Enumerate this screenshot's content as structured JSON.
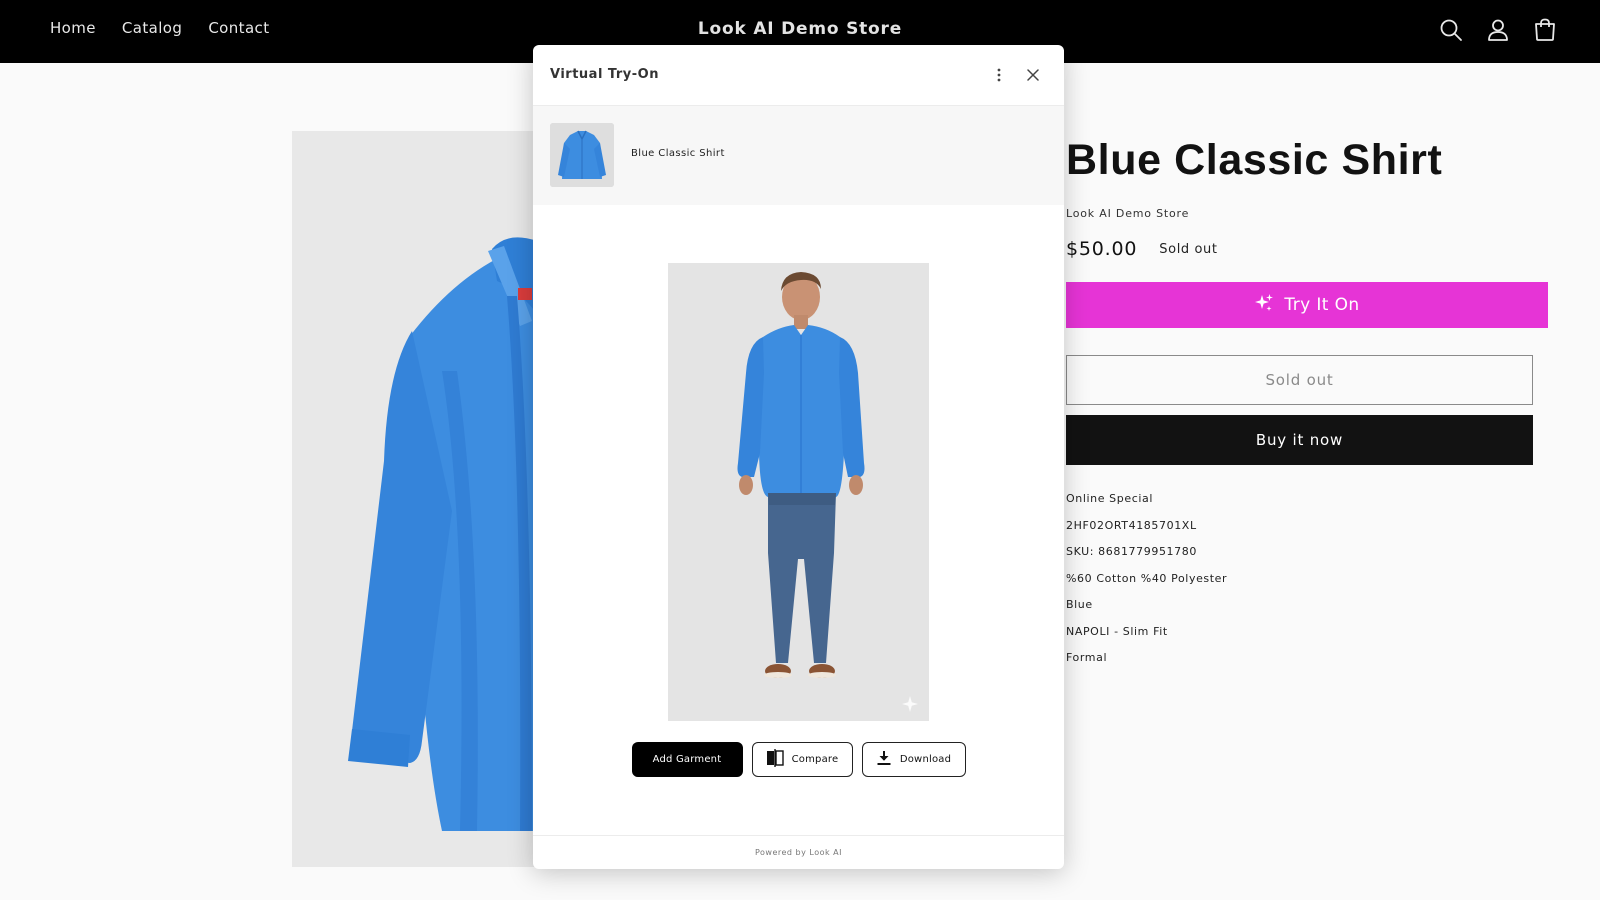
{
  "header": {
    "nav": [
      "Home",
      "Catalog",
      "Contact"
    ],
    "store_name": "Look AI Demo Store",
    "icons": [
      "search-icon",
      "account-icon",
      "cart-icon"
    ]
  },
  "product": {
    "title": "Blue Classic Shirt",
    "vendor": "Look AI Demo Store",
    "price": "$50.00",
    "badge": "Sold out",
    "try_on_label": "Try It On",
    "sold_out_label": "Sold out",
    "buy_now_label": "Buy it now",
    "specs": [
      "Online Special",
      "2HF02ORT4185701XL",
      "SKU: 8681779951780",
      "%60 Cotton %40 Polyester",
      "Blue",
      "NAPOLI - Slim Fit",
      "Formal"
    ]
  },
  "modal": {
    "title": "Virtual Try-On",
    "garment_name": "Blue Classic Shirt",
    "add_garment_label": "Add Garment",
    "compare_label": "Compare",
    "download_label": "Download",
    "footer": "Powered by Look AI"
  },
  "colors": {
    "header_bg": "#000000",
    "accent_try_on": "#e634d6",
    "shirt_blue": "#3d8de0",
    "buy_button": "#121212"
  }
}
